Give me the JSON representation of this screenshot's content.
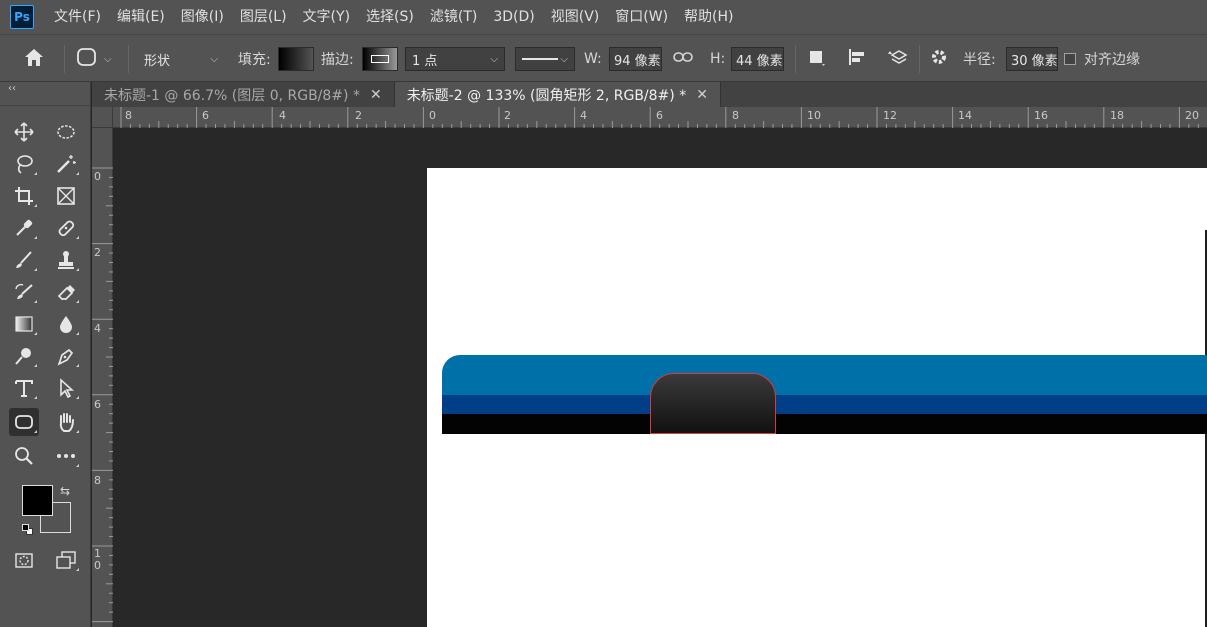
{
  "app": {
    "logo": "Ps"
  },
  "menu": [
    "文件(F)",
    "编辑(E)",
    "图像(I)",
    "图层(L)",
    "文字(Y)",
    "选择(S)",
    "滤镜(T)",
    "3D(D)",
    "视图(V)",
    "窗口(W)",
    "帮助(H)"
  ],
  "options": {
    "mode": "形状",
    "fill_label": "填充:",
    "stroke_label": "描边:",
    "stroke_width": "1 点",
    "w_label": "W:",
    "w_value": "94 像素",
    "h_label": "H:",
    "h_value": "44 像素",
    "radius_label": "半径:",
    "radius_value": "30 像素",
    "align_edges_label": "对齐边缘"
  },
  "tabs": [
    {
      "label": "未标题-1 @ 66.7% (图层 0, RGB/8#) *",
      "active": false
    },
    {
      "label": "未标题-2 @ 133% (圆角矩形 2, RGB/8#) *",
      "active": true
    }
  ],
  "ruler": {
    "horizontal": [
      "8",
      "6",
      "4",
      "2",
      "0",
      "2",
      "4",
      "6",
      "8",
      "10",
      "12",
      "14",
      "16",
      "18",
      "20"
    ],
    "vertical": [
      "0",
      "2",
      "4",
      "6",
      "8",
      "10"
    ]
  },
  "colors": {
    "foreground": "#000000",
    "background": "#ffffff",
    "bar_blue": "#0070a8",
    "bar_navy": "#003f88",
    "selection_outline": "#d43c3c"
  },
  "tools": [
    "move-tool",
    "marquee-tool",
    "lasso-tool",
    "magic-wand-tool",
    "crop-tool",
    "frame-tool",
    "eyedropper-tool",
    "healing-brush-tool",
    "brush-tool",
    "clone-stamp-tool",
    "history-brush-tool",
    "eraser-tool",
    "gradient-tool",
    "blur-tool",
    "dodge-tool",
    "pen-tool",
    "type-tool",
    "path-selection-tool",
    "rounded-rectangle-tool",
    "hand-tool",
    "zoom-tool",
    "more-tools"
  ]
}
